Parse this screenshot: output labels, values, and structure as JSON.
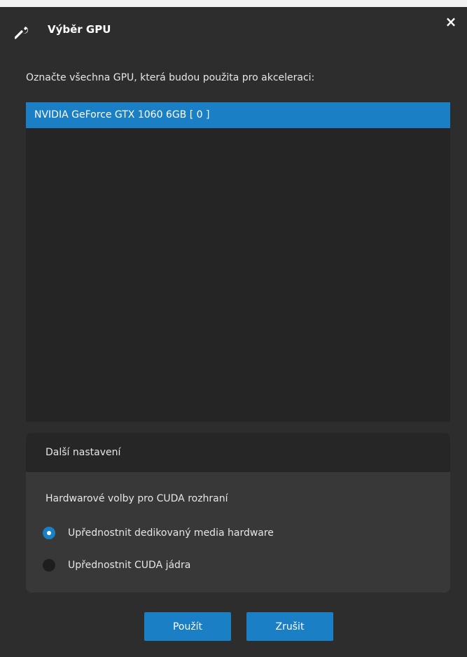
{
  "dialog": {
    "title": "Výběr GPU",
    "close_glyph": "×"
  },
  "instruction": "Označte všechna GPU, která budou použita pro akceleraci:",
  "gpu_list": [
    {
      "label": "NVIDIA GeForce GTX 1060 6GB [ 0 ]",
      "selected": true
    }
  ],
  "settings": {
    "header": "Další nastavení",
    "cuda_label": "Hardwarové volby pro CUDA rozhraní",
    "options": [
      {
        "label": "Upřednostnit dedikovaný media hardware",
        "checked": true
      },
      {
        "label": "Upřednostnit CUDA jádra",
        "checked": false
      }
    ]
  },
  "buttons": {
    "apply": "Použít",
    "cancel": "Zrušit"
  },
  "colors": {
    "background": "#2d2d2d",
    "accent": "#1a7fc4",
    "list_bg": "#252525",
    "panel_bg": "#383838"
  },
  "icons": {
    "title": "wrench-icon",
    "close": "close-icon"
  }
}
